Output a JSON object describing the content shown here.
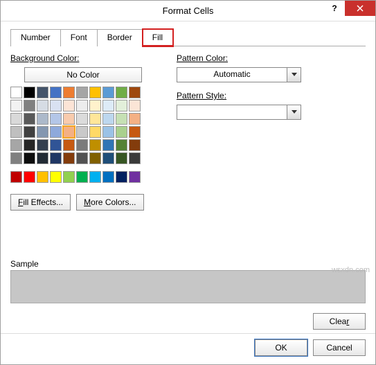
{
  "title": "Format Cells",
  "tabs": [
    "Number",
    "Font",
    "Border",
    "Fill"
  ],
  "active_tab_index": 3,
  "fill": {
    "background_label": "Background Color:",
    "no_color_label": "No Color",
    "fill_effects_label": "Fill Effects...",
    "more_colors_label": "More Colors...",
    "theme_colors": [
      [
        "#FFFFFF",
        "#000000",
        "#44546A",
        "#4472C4",
        "#ED7D31",
        "#A5A5A5",
        "#FFC000",
        "#5B9BD5",
        "#70AD47",
        "#9E480E"
      ],
      [
        "#F2F2F2",
        "#808080",
        "#D6DCE4",
        "#D9E1F2",
        "#FCE4D6",
        "#EDEDED",
        "#FFF2CC",
        "#DDEBF7",
        "#E2EFDA",
        "#FBE5D6"
      ],
      [
        "#D9D9D9",
        "#595959",
        "#ACB9CA",
        "#B4C6E7",
        "#F8CBAD",
        "#DBDBDB",
        "#FFE699",
        "#BDD7EE",
        "#C6E0B4",
        "#F4B084"
      ],
      [
        "#BFBFBF",
        "#404040",
        "#8497B0",
        "#8EA9DB",
        "#F4B084",
        "#C9C9C9",
        "#FFD966",
        "#9BC2E6",
        "#A9D08E",
        "#C65911"
      ],
      [
        "#A6A6A6",
        "#262626",
        "#333F4F",
        "#305496",
        "#C65911",
        "#7B7B7B",
        "#BF8F00",
        "#2F75B5",
        "#548235",
        "#833C0C"
      ],
      [
        "#808080",
        "#0D0D0D",
        "#222B35",
        "#203764",
        "#833C0C",
        "#525252",
        "#806000",
        "#1F4E78",
        "#375623",
        "#3A3A3A"
      ]
    ],
    "standard_colors": [
      "#C00000",
      "#FF0000",
      "#FFC000",
      "#FFFF00",
      "#92D050",
      "#00B050",
      "#00B0F0",
      "#0070C0",
      "#002060",
      "#7030A0"
    ],
    "selected_swatch": "3,4"
  },
  "pattern": {
    "color_label": "Pattern Color:",
    "color_value": "Automatic",
    "style_label": "Pattern Style:",
    "style_value": ""
  },
  "sample_label": "Sample",
  "clear_label": "Clear",
  "ok_label": "OK",
  "cancel_label": "Cancel",
  "watermark": "wsxdn.com"
}
